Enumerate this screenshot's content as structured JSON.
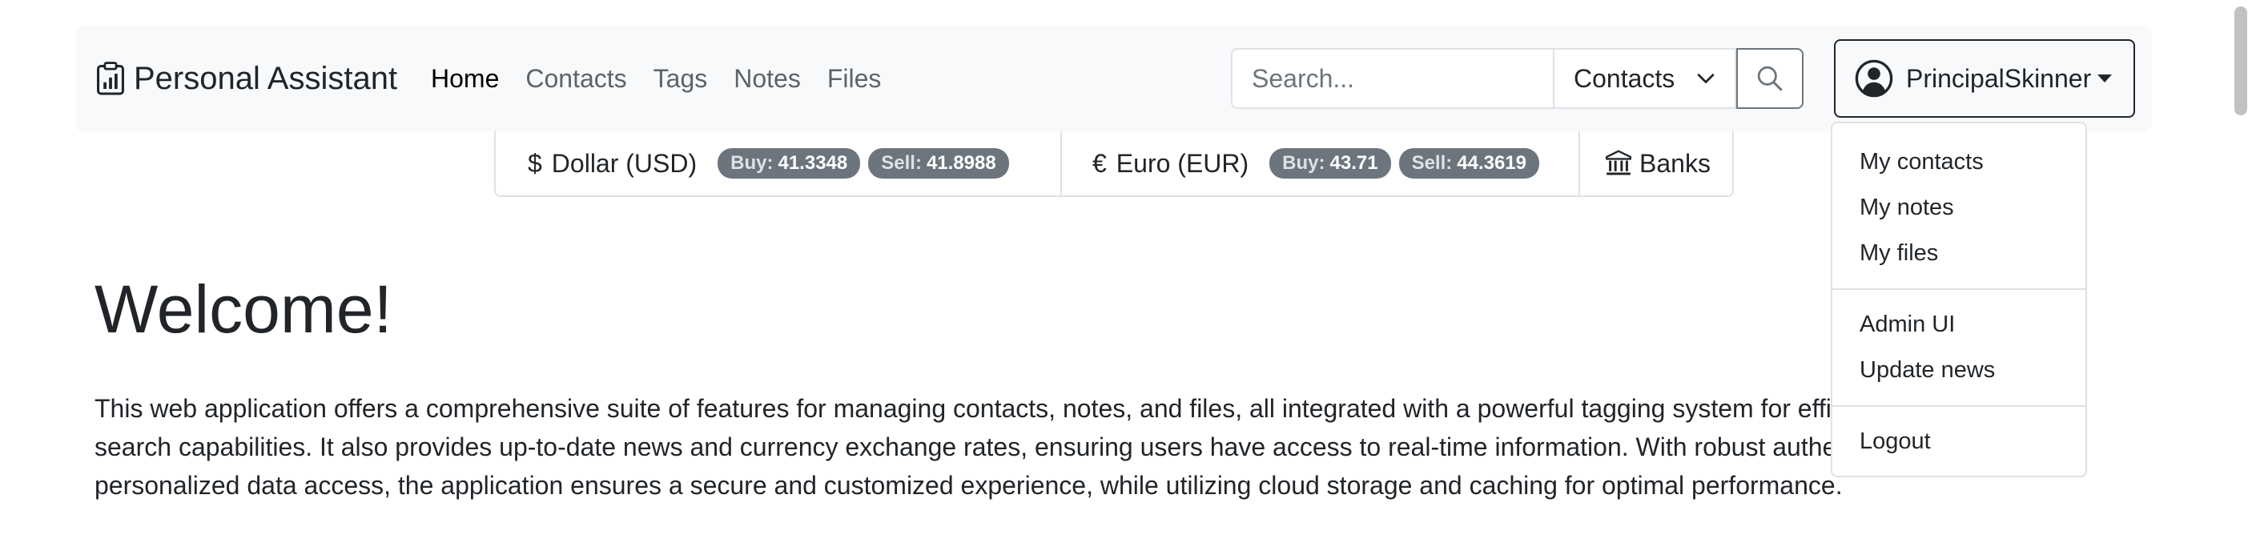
{
  "brand": {
    "name": "Personal Assistant",
    "icon": "clipboard-chart-icon"
  },
  "nav": {
    "items": [
      {
        "label": "Home",
        "active": true
      },
      {
        "label": "Contacts"
      },
      {
        "label": "Tags"
      },
      {
        "label": "Notes"
      },
      {
        "label": "Files"
      }
    ]
  },
  "search": {
    "placeholder": "Search...",
    "scope_value": "Contacts",
    "button_icon": "search-icon"
  },
  "user": {
    "name": "PrincipalSkinner",
    "avatar_icon": "person-circle-icon"
  },
  "currencies": [
    {
      "symbol": "$",
      "name": "Dollar (USD)",
      "buy_label": "Buy:",
      "buy": "41.3348",
      "sell_label": "Sell:",
      "sell": "41.8988"
    },
    {
      "symbol": "€",
      "name": "Euro (EUR)",
      "buy_label": "Buy:",
      "buy": "43.71",
      "sell_label": "Sell:",
      "sell": "44.3619"
    }
  ],
  "banks": {
    "label": "Banks",
    "icon": "bank-icon"
  },
  "main": {
    "title": "Welcome!",
    "description": "This web application offers a comprehensive suite of features for managing contacts, notes, and files, all integrated with a powerful tagging system for efficient organization and search capabilities. It also provides up-to-date news and currency exchange rates, ensuring users have access to real-time information. With robust authentication and personalized data access, the application ensures a secure and customized experience, while utilizing cloud storage and caching for optimal performance."
  },
  "user_menu": {
    "group1": [
      "My contacts",
      "My notes",
      "My files"
    ],
    "group2": [
      "Admin UI",
      "Update news"
    ],
    "group3": [
      "Logout"
    ]
  },
  "colors": {
    "navbar_bg": "#f8f9fa",
    "badge_bg": "#6c757d",
    "border": "#dee2e6",
    "text": "#212529"
  }
}
